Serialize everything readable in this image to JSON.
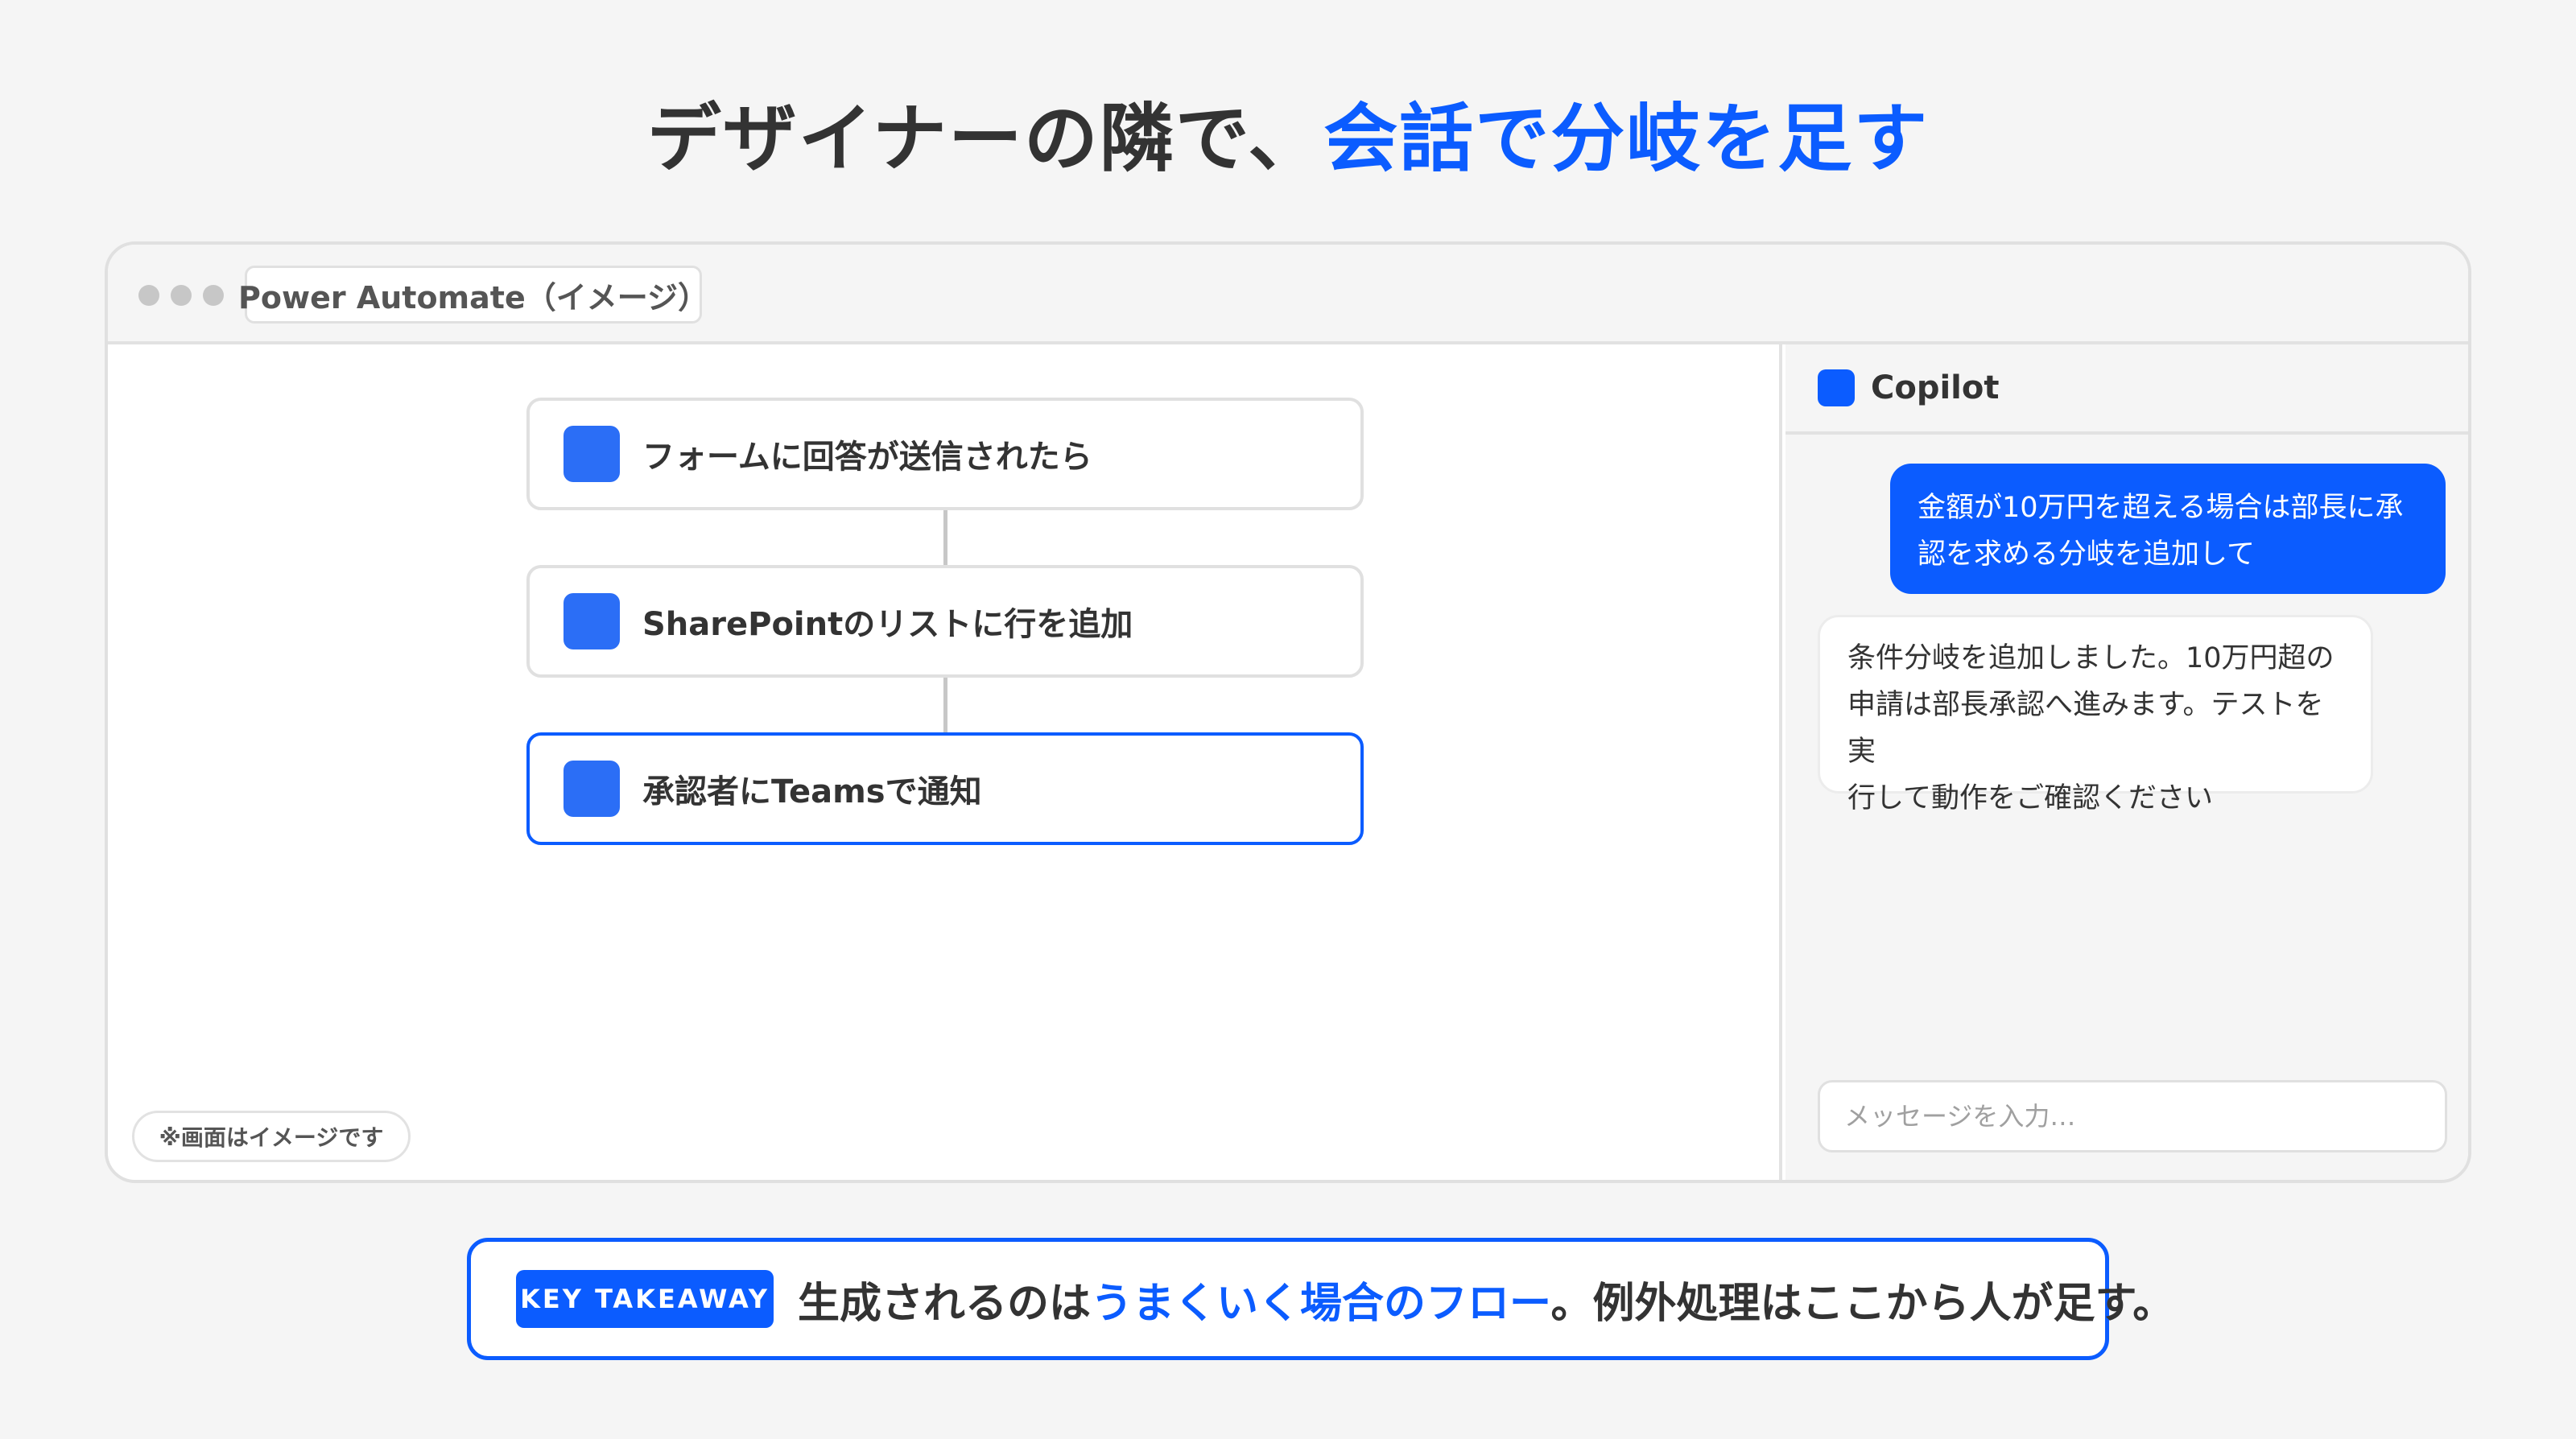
{
  "headline": {
    "part1": "デザイナーの隣で、",
    "part2": "会話で分岐を足す"
  },
  "window": {
    "tab_title": "Power Automate（イメージ）",
    "flow_steps": [
      {
        "label": "フォームに回答が送信されたら",
        "icon": "trigger-icon"
      },
      {
        "label": "SharePointのリストに行を追加",
        "icon": "action-icon"
      },
      {
        "label": "承認者にTeamsで通知",
        "icon": "action-icon",
        "selected": true
      }
    ],
    "note": "※画面はイメージです"
  },
  "copilot": {
    "title": "Copilot",
    "user_message_lines": [
      "金額が10万円を超える場合は部長に承",
      "認を求める分岐を追加して"
    ],
    "bot_message_lines": [
      "条件分岐を追加しました。10万円超の",
      "申請は部長承認へ進みます。テストを実",
      "行して動作をご確認ください"
    ],
    "input_placeholder": "メッセージを入力…"
  },
  "takeaway": {
    "badge": "KEY TAKEAWAY",
    "text1": "生成されるのは",
    "text2": "うまくいく場合のフロー",
    "text3": "。例外処理はここから人が足す。"
  },
  "colors": {
    "accent": "#0b5cff",
    "step_icon": "#2b6ef6",
    "text": "#333333"
  }
}
